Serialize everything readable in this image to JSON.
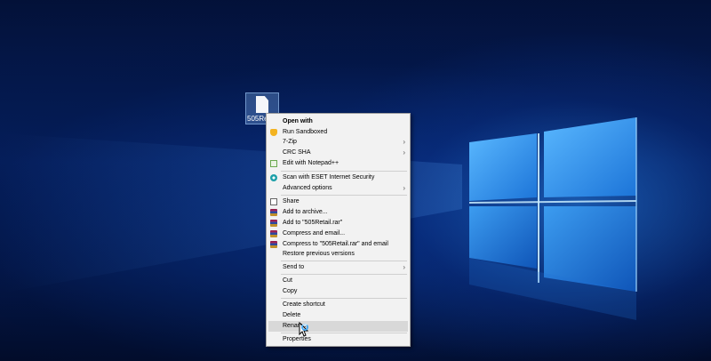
{
  "desktop": {
    "file": {
      "label": "505Retail"
    }
  },
  "context_menu": {
    "items": [
      {
        "label": "Open with",
        "icon": "none",
        "bold": true
      },
      {
        "label": "Run Sandboxed",
        "icon": "shield-icon"
      },
      {
        "label": "7-Zip",
        "icon": "none",
        "submenu": true
      },
      {
        "label": "CRC SHA",
        "icon": "none",
        "submenu": true
      },
      {
        "label": "Edit with Notepad++",
        "icon": "notepad-plus-plus-icon"
      },
      {
        "label": "Scan with ESET Internet Security",
        "icon": "eset-icon"
      },
      {
        "label": "Advanced options",
        "icon": "none",
        "submenu": true
      },
      {
        "label": "Share",
        "icon": "share-icon"
      },
      {
        "label": "Add to archive...",
        "icon": "winrar-icon"
      },
      {
        "label": "Add to \"505Retail.rar\"",
        "icon": "winrar-icon"
      },
      {
        "label": "Compress and email...",
        "icon": "winrar-icon"
      },
      {
        "label": "Compress to \"505Retail.rar\" and email",
        "icon": "winrar-icon"
      },
      {
        "label": "Restore previous versions",
        "icon": "none"
      },
      {
        "label": "Send to",
        "icon": "none",
        "submenu": true
      },
      {
        "label": "Cut",
        "icon": "none"
      },
      {
        "label": "Copy",
        "icon": "none"
      },
      {
        "label": "Create shortcut",
        "icon": "none"
      },
      {
        "label": "Delete",
        "icon": "none"
      },
      {
        "label": "Rename",
        "icon": "none",
        "highlighted": true
      },
      {
        "label": "Properties",
        "icon": "none"
      }
    ],
    "submenu_arrow": "›"
  },
  "colors": {
    "menu_background": "#f2f2f2",
    "menu_highlight": "#d8d8d8",
    "desktop_accent": "#1e7fe0"
  }
}
